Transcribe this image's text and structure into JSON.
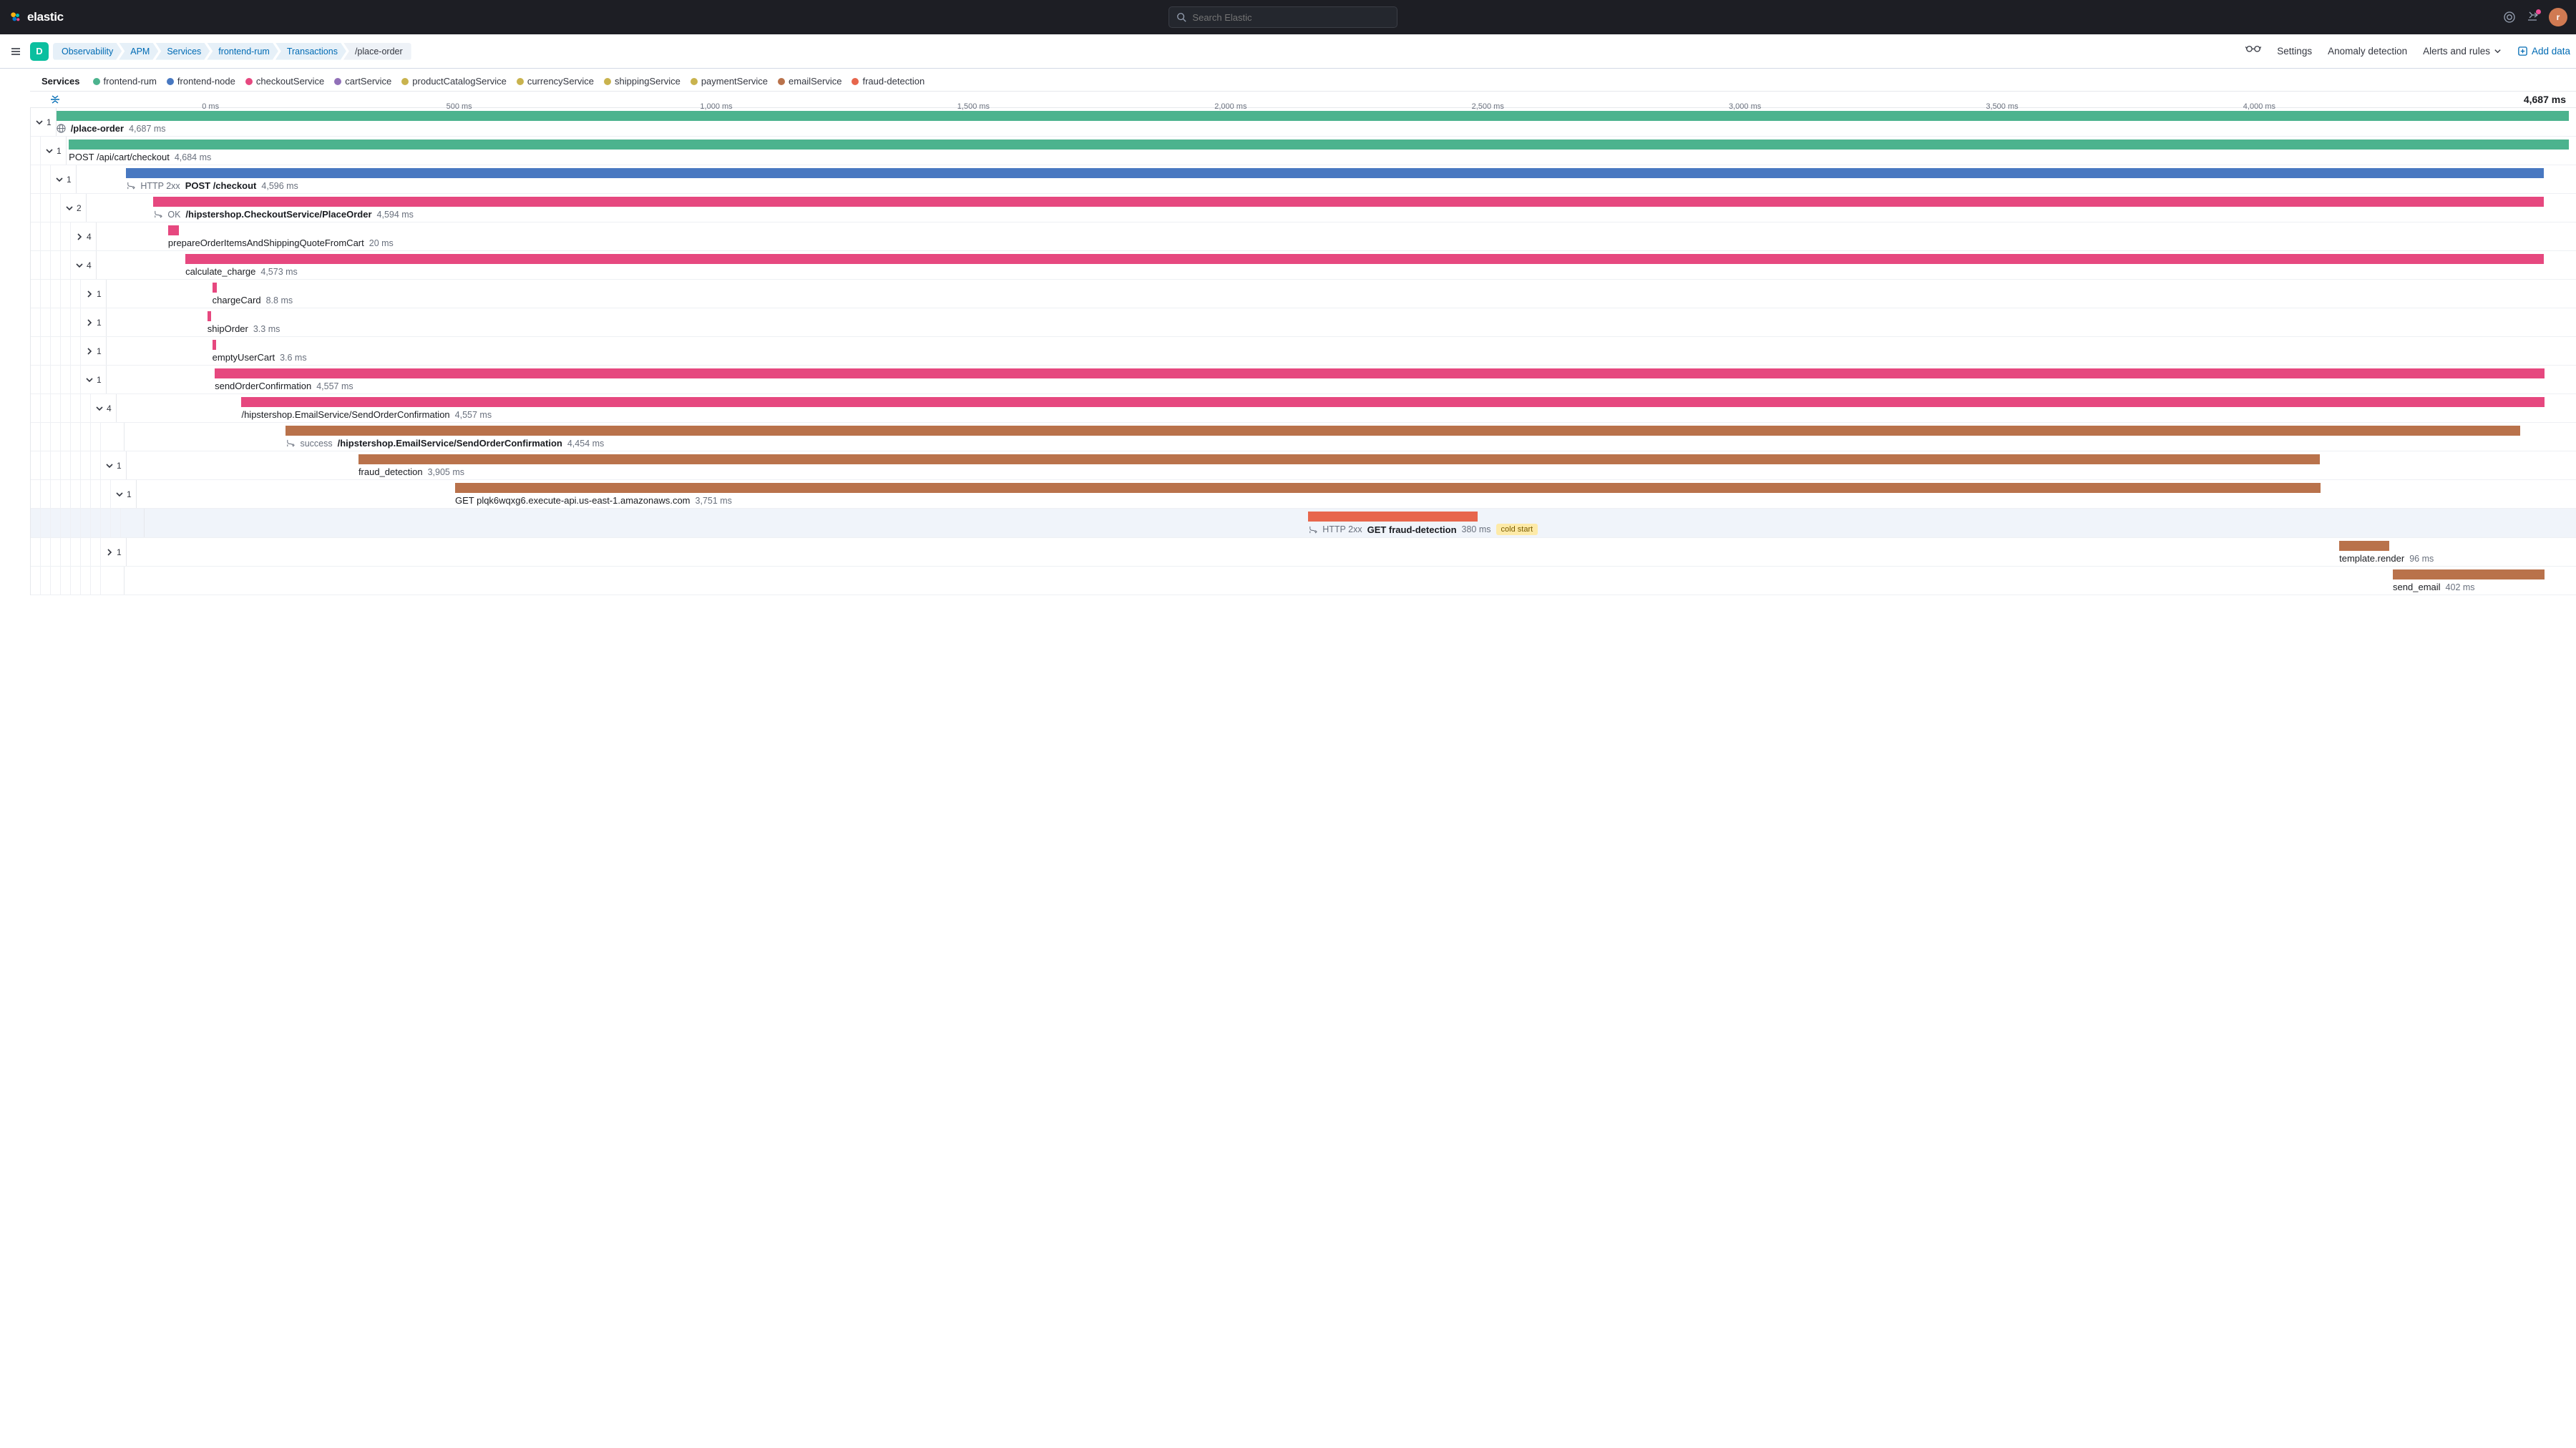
{
  "header": {
    "brand": "elastic",
    "search_placeholder": "Search Elastic",
    "avatar_initial": "r"
  },
  "subheader": {
    "space_initial": "D",
    "crumbs": [
      "Observability",
      "APM",
      "Services",
      "frontend-rum",
      "Transactions",
      "/place-order"
    ],
    "links": {
      "settings": "Settings",
      "anomaly": "Anomaly detection",
      "alerts": "Alerts and rules",
      "add_data": "Add data"
    }
  },
  "legend": {
    "label": "Services",
    "items": [
      {
        "name": "frontend-rum",
        "color": "#4cb38e"
      },
      {
        "name": "frontend-node",
        "color": "#4878c1"
      },
      {
        "name": "checkoutService",
        "color": "#e6487f"
      },
      {
        "name": "cartService",
        "color": "#9170b8"
      },
      {
        "name": "productCatalogService",
        "color": "#c9b34e"
      },
      {
        "name": "currencyService",
        "color": "#c9b34e"
      },
      {
        "name": "shippingService",
        "color": "#c9b34e"
      },
      {
        "name": "paymentService",
        "color": "#c9b34e"
      },
      {
        "name": "emailService",
        "color": "#b9724b"
      },
      {
        "name": "fraud-detection",
        "color": "#e7664c"
      }
    ]
  },
  "axis": {
    "ticks": [
      "0 ms",
      "500 ms",
      "1,000 ms",
      "1,500 ms",
      "2,000 ms",
      "2,500 ms",
      "3,000 ms",
      "3,500 ms",
      "4,000 ms"
    ],
    "total": "4,687 ms"
  },
  "rows": [
    {
      "depth": 0,
      "count": "1",
      "open": true,
      "color": "#4cb38e",
      "left": 0.0,
      "width": 100.0,
      "icon": "globe",
      "prefix": "",
      "name": "/place-order",
      "bold": true,
      "dur": "4,687 ms",
      "badge": ""
    },
    {
      "depth": 1,
      "count": "1",
      "open": true,
      "color": "#4cb38e",
      "left": 0.1,
      "width": 99.9,
      "icon": "",
      "prefix": "",
      "name": "POST /api/cart/checkout",
      "bold": false,
      "dur": "4,684 ms",
      "badge": ""
    },
    {
      "depth": 2,
      "count": "1",
      "open": true,
      "color": "#4878c1",
      "left": 2.0,
      "width": 97.0,
      "icon": "merge",
      "prefix": "HTTP 2xx",
      "name": "POST /checkout",
      "bold": true,
      "dur": "4,596 ms",
      "badge": ""
    },
    {
      "depth": 3,
      "count": "2",
      "open": true,
      "color": "#e6487f",
      "left": 2.7,
      "width": 96.3,
      "icon": "merge",
      "prefix": "OK",
      "name": "/hipstershop.CheckoutService/PlaceOrder",
      "bold": true,
      "dur": "4,594 ms",
      "badge": ""
    },
    {
      "depth": 4,
      "count": "4",
      "open": false,
      "color": "#e6487f",
      "left": 2.9,
      "width": 0.43,
      "icon": "",
      "prefix": "",
      "name": "prepareOrderItemsAndShippingQuoteFromCart",
      "bold": false,
      "dur": "20 ms",
      "badge": ""
    },
    {
      "depth": 4,
      "count": "4",
      "open": true,
      "color": "#e6487f",
      "left": 3.6,
      "width": 95.4,
      "icon": "",
      "prefix": "",
      "name": "calculate_charge",
      "bold": false,
      "dur": "4,573 ms",
      "badge": ""
    },
    {
      "depth": 5,
      "count": "1",
      "open": false,
      "color": "#e6487f",
      "left": 4.3,
      "width": 0.19,
      "icon": "",
      "prefix": "",
      "name": "chargeCard",
      "bold": false,
      "dur": "8.8 ms",
      "badge": ""
    },
    {
      "depth": 5,
      "count": "1",
      "open": false,
      "color": "#e6487f",
      "left": 4.1,
      "width": 0.15,
      "icon": "",
      "prefix": "",
      "name": "shipOrder",
      "bold": false,
      "dur": "3.3 ms",
      "badge": ""
    },
    {
      "depth": 5,
      "count": "1",
      "open": false,
      "color": "#e6487f",
      "left": 4.3,
      "width": 0.15,
      "icon": "",
      "prefix": "",
      "name": "emptyUserCart",
      "bold": false,
      "dur": "3.6 ms",
      "badge": ""
    },
    {
      "depth": 5,
      "count": "1",
      "open": true,
      "color": "#e6487f",
      "left": 4.4,
      "width": 94.6,
      "icon": "",
      "prefix": "",
      "name": "sendOrderConfirmation",
      "bold": false,
      "dur": "4,557 ms",
      "badge": ""
    },
    {
      "depth": 6,
      "count": "4",
      "open": true,
      "color": "#e6487f",
      "left": 5.1,
      "width": 93.9,
      "icon": "",
      "prefix": "",
      "name": "/hipstershop.EmailService/SendOrderConfirmation",
      "bold": false,
      "dur": "4,557 ms",
      "badge": ""
    },
    {
      "depth": 7,
      "count": "",
      "open": null,
      "color": "#b9724b",
      "left": 6.6,
      "width": 91.4,
      "icon": "merge",
      "prefix": "success",
      "name": "/hipstershop.EmailService/SendOrderConfirmation",
      "bold": true,
      "dur": "4,454 ms",
      "badge": ""
    },
    {
      "depth": 7,
      "count": "1",
      "open": true,
      "color": "#b9724b",
      "left": 9.5,
      "width": 80.3,
      "icon": "",
      "prefix": "",
      "name": "fraud_detection",
      "bold": false,
      "dur": "3,905 ms",
      "badge": ""
    },
    {
      "depth": 8,
      "count": "1",
      "open": true,
      "color": "#b9724b",
      "left": 13.1,
      "width": 76.7,
      "icon": "",
      "prefix": "",
      "name": "GET plqk6wqxg6.execute-api.us-east-1.amazonaws.com",
      "bold": false,
      "dur": "3,751 ms",
      "badge": ""
    },
    {
      "depth": 9,
      "count": "",
      "open": null,
      "color": "#e7664c",
      "left": 48.0,
      "width": 7.0,
      "icon": "merge",
      "prefix": "HTTP 2xx",
      "name": "GET fraud-detection",
      "bold": true,
      "dur": "380 ms",
      "badge": "cold start",
      "selected": true
    },
    {
      "depth": 7,
      "count": "1",
      "open": false,
      "color": "#b9724b",
      "left": 90.6,
      "width": 2.05,
      "icon": "",
      "prefix": "",
      "name": "template.render",
      "bold": false,
      "dur": "96 ms",
      "badge": ""
    },
    {
      "depth": 7,
      "count": "",
      "open": null,
      "color": "#b9724b",
      "left": 92.8,
      "width": 6.2,
      "icon": "",
      "prefix": "",
      "name": "send_email",
      "bold": false,
      "dur": "402 ms",
      "badge": ""
    }
  ]
}
